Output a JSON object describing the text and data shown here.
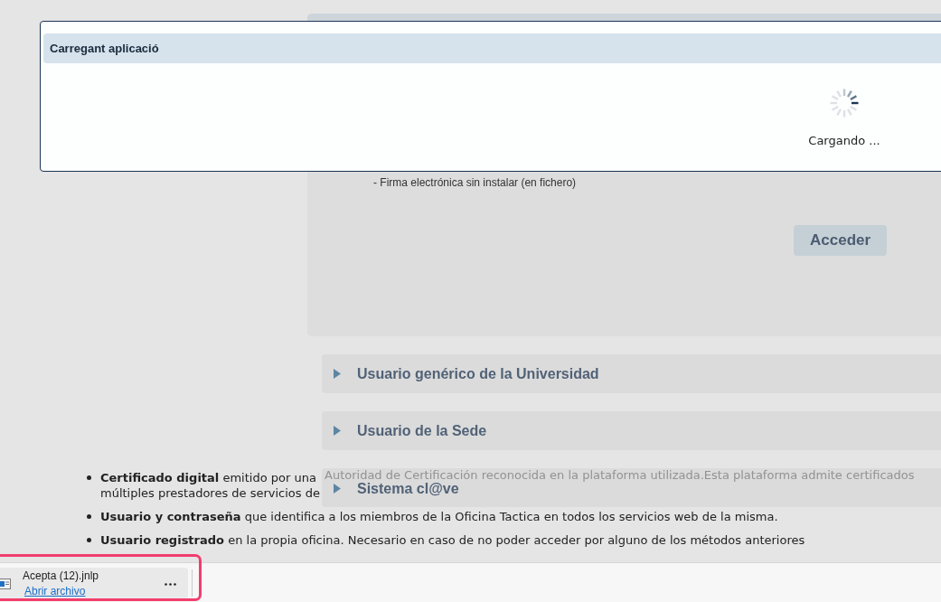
{
  "login_panel": {
    "option_text": "- Firma electrónica sin instalar (en fichero)",
    "button": "Acceder"
  },
  "dialog": {
    "title": "Carregant aplicació",
    "message": "Cargando ..."
  },
  "accordions": [
    {
      "title": "Usuario genérico de la Universidad",
      "expanded": false
    },
    {
      "title": "Usuario de la Sede",
      "expanded": false
    },
    {
      "title": "Sistema cl@ve",
      "expanded": false,
      "show_through": "Autoridad de Certificación reconocida en la plataforma utilizada.Esta plataforma admite certificados"
    }
  ],
  "access_methods": [
    {
      "lines": [
        "**Certificado digital** emitido por una",
        "múltiples prestadores de servicios de"
      ]
    },
    {
      "lines": [
        "**Usuario y contraseña** que identifica a los miembros de la Oficina Tactica en todos los servicios web de la misma."
      ]
    },
    {
      "lines": [
        "**Usuario registrado** en la propia oficina. Necesario en caso de no poder acceder por alguno de los métodos anteriores"
      ]
    }
  ],
  "download_bar": {
    "items": [
      {
        "filename": "Acepta (12).jnlp",
        "action": "Abrir archivo"
      }
    ]
  }
}
